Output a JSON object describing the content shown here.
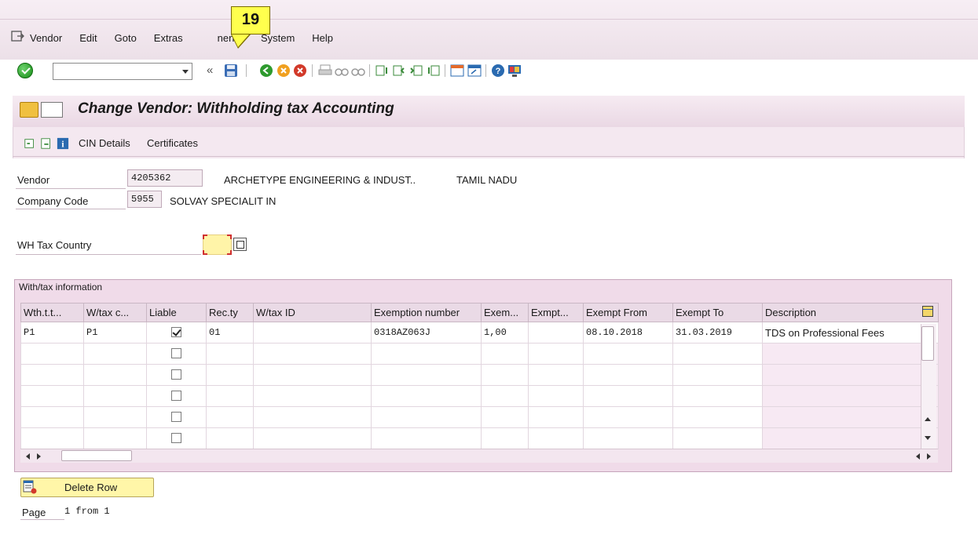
{
  "menu": {
    "items": [
      "Vendor",
      "Edit",
      "Goto",
      "Extras",
      "nent",
      "System",
      "Help"
    ]
  },
  "toolbar": {
    "command_field_value": "",
    "icons": [
      "check-icon",
      "back-icon",
      "save-icon",
      "exit-icon",
      "cancel-icon",
      "print-icon",
      "find-icon",
      "find-next-icon",
      "first-page-icon",
      "prev-page-icon",
      "next-page-icon",
      "last-page-icon",
      "create-session-icon",
      "shortcut-icon",
      "help-icon",
      "customize-icon"
    ]
  },
  "callout": {
    "number": "19"
  },
  "page": {
    "title": "Change Vendor: Withholding tax Accounting"
  },
  "app_toolbar": {
    "cin_details": "CIN Details",
    "certificates": "Certificates"
  },
  "header": {
    "vendor_label": "Vendor",
    "vendor_value": "4205362",
    "vendor_name": "ARCHETYPE ENGINEERING & INDUST..",
    "vendor_region": "TAMIL NADU",
    "company_label": "Company Code",
    "company_value": "5955",
    "company_name": "SOLVAY SPECIALIT IN",
    "wh_country_label": "WH Tax Country",
    "wh_country_value": ""
  },
  "group": {
    "title": "With/tax information",
    "columns": [
      "Wth.t.t...",
      "W/tax c...",
      "Liable",
      "Rec.ty",
      "W/tax ID",
      "Exemption number",
      "Exem...",
      "Exmpt...",
      "Exempt From",
      "Exempt To",
      "Description"
    ],
    "rows": [
      {
        "wht_type": "P1",
        "wht_code": "P1",
        "liable": true,
        "rec_type": "01",
        "wtax_id": "",
        "exemption_number": "0318AZ063J",
        "exem_rate": "1,00",
        "exmpt_reason": "",
        "exempt_from": "08.10.2018",
        "exempt_to": "31.03.2019",
        "description": "TDS on Professional Fees"
      },
      {
        "wht_type": "",
        "wht_code": "",
        "liable": false,
        "rec_type": "",
        "wtax_id": "",
        "exemption_number": "",
        "exem_rate": "",
        "exmpt_reason": "",
        "exempt_from": "",
        "exempt_to": "",
        "description": ""
      },
      {
        "wht_type": "",
        "wht_code": "",
        "liable": false,
        "rec_type": "",
        "wtax_id": "",
        "exemption_number": "",
        "exem_rate": "",
        "exmpt_reason": "",
        "exempt_from": "",
        "exempt_to": "",
        "description": ""
      },
      {
        "wht_type": "",
        "wht_code": "",
        "liable": false,
        "rec_type": "",
        "wtax_id": "",
        "exemption_number": "",
        "exem_rate": "",
        "exmpt_reason": "",
        "exempt_from": "",
        "exempt_to": "",
        "description": ""
      },
      {
        "wht_type": "",
        "wht_code": "",
        "liable": false,
        "rec_type": "",
        "wtax_id": "",
        "exemption_number": "",
        "exem_rate": "",
        "exmpt_reason": "",
        "exempt_from": "",
        "exempt_to": "",
        "description": ""
      },
      {
        "wht_type": "",
        "wht_code": "",
        "liable": false,
        "rec_type": "",
        "wtax_id": "",
        "exemption_number": "",
        "exem_rate": "",
        "exmpt_reason": "",
        "exempt_from": "",
        "exempt_to": "",
        "description": ""
      }
    ]
  },
  "actions": {
    "delete_row": "Delete Row"
  },
  "pager": {
    "label": "Page",
    "value": "1 from 1"
  },
  "colors": {
    "panel_bg": "#f4e8f0",
    "group_bg": "#f0dbe9",
    "button_yellow": "#fff6a8",
    "callout_yellow": "#ffff4d"
  }
}
